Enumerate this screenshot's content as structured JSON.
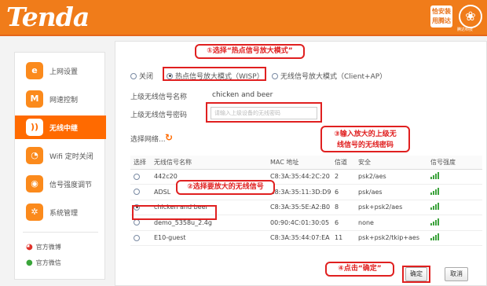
{
  "header": {
    "logo": "Tenda",
    "badge": "恰安装\n用腾达",
    "emblem_caption": "腾达科技"
  },
  "sidebar": {
    "items": [
      {
        "label": "上网设置",
        "icon": "ie-globe-icon",
        "glyph": "e",
        "active": false
      },
      {
        "label": "网速控制",
        "icon": "speed-wave-icon",
        "glyph": "M",
        "active": false
      },
      {
        "label": "无线中继",
        "icon": "wifi-icon",
        "glyph": "))",
        "active": true
      },
      {
        "label": "Wifi 定时关闭",
        "icon": "clock-icon",
        "glyph": "◔",
        "active": false
      },
      {
        "label": "信号强度调节",
        "icon": "signal-icon",
        "glyph": "◉",
        "active": false
      },
      {
        "label": "系统管理",
        "icon": "gear-icon",
        "glyph": "✲",
        "active": false
      }
    ],
    "social": [
      {
        "label": "官方微博",
        "icon": "weibo-icon"
      },
      {
        "label": "官方微信",
        "icon": "wechat-icon"
      }
    ]
  },
  "mode": {
    "options": [
      {
        "label": "关闭",
        "selected": false
      },
      {
        "label": "热点信号放大模式（WISP）",
        "selected": true
      },
      {
        "label": "无线信号放大模式（Client+AP）",
        "selected": false
      }
    ]
  },
  "upstream": {
    "ssid_label": "上级无线信号名称",
    "ssid_value": "chicken and beer",
    "password_label": "上级无线信号密码",
    "password_placeholder": "请输入上级设备的无线密码"
  },
  "scan": {
    "label": "选择网络...",
    "icon": "refresh-icon"
  },
  "table": {
    "headers": [
      "选择",
      "无线信号名称",
      "MAC 地址",
      "信道",
      "安全",
      "信号强度"
    ],
    "rows": [
      {
        "selected": false,
        "ssid": "442c20",
        "mac": "C8:3A:35:44:2C:20",
        "channel": "2",
        "security": "psk2/aes",
        "signal": 4
      },
      {
        "selected": false,
        "ssid": "ADSL",
        "mac": "C8:3A:35:11:3D:D9",
        "channel": "6",
        "security": "psk/aes",
        "signal": 4
      },
      {
        "selected": true,
        "ssid": "chicken and beer",
        "mac": "C8:3A:35:5E:A2:B0",
        "channel": "8",
        "security": "psk+psk2/aes",
        "signal": 4
      },
      {
        "selected": false,
        "ssid": "demo_5358u_2.4g",
        "mac": "00:90:4C:01:30:05",
        "channel": "6",
        "security": "none",
        "signal": 4
      },
      {
        "selected": false,
        "ssid": "E10-guest",
        "mac": "C8:3A:35:44:07:EA",
        "channel": "11",
        "security": "psk+psk2/tkip+aes",
        "signal": 4
      }
    ]
  },
  "annotations": {
    "step1": "①选择“热点信号放大模式”",
    "step2": "②选择要放大的无线信号",
    "step3_line1": "③输入放大的上级无",
    "step3_line2": "线信号的无线密码",
    "step4": "④点击“确定”"
  },
  "buttons": {
    "ok": "确定",
    "cancel": "取消"
  },
  "colors": {
    "brand_orange": "#f07c1a",
    "active_orange": "#ff6a00",
    "annotation_red": "#e02020",
    "signal_green": "#3da33d"
  }
}
